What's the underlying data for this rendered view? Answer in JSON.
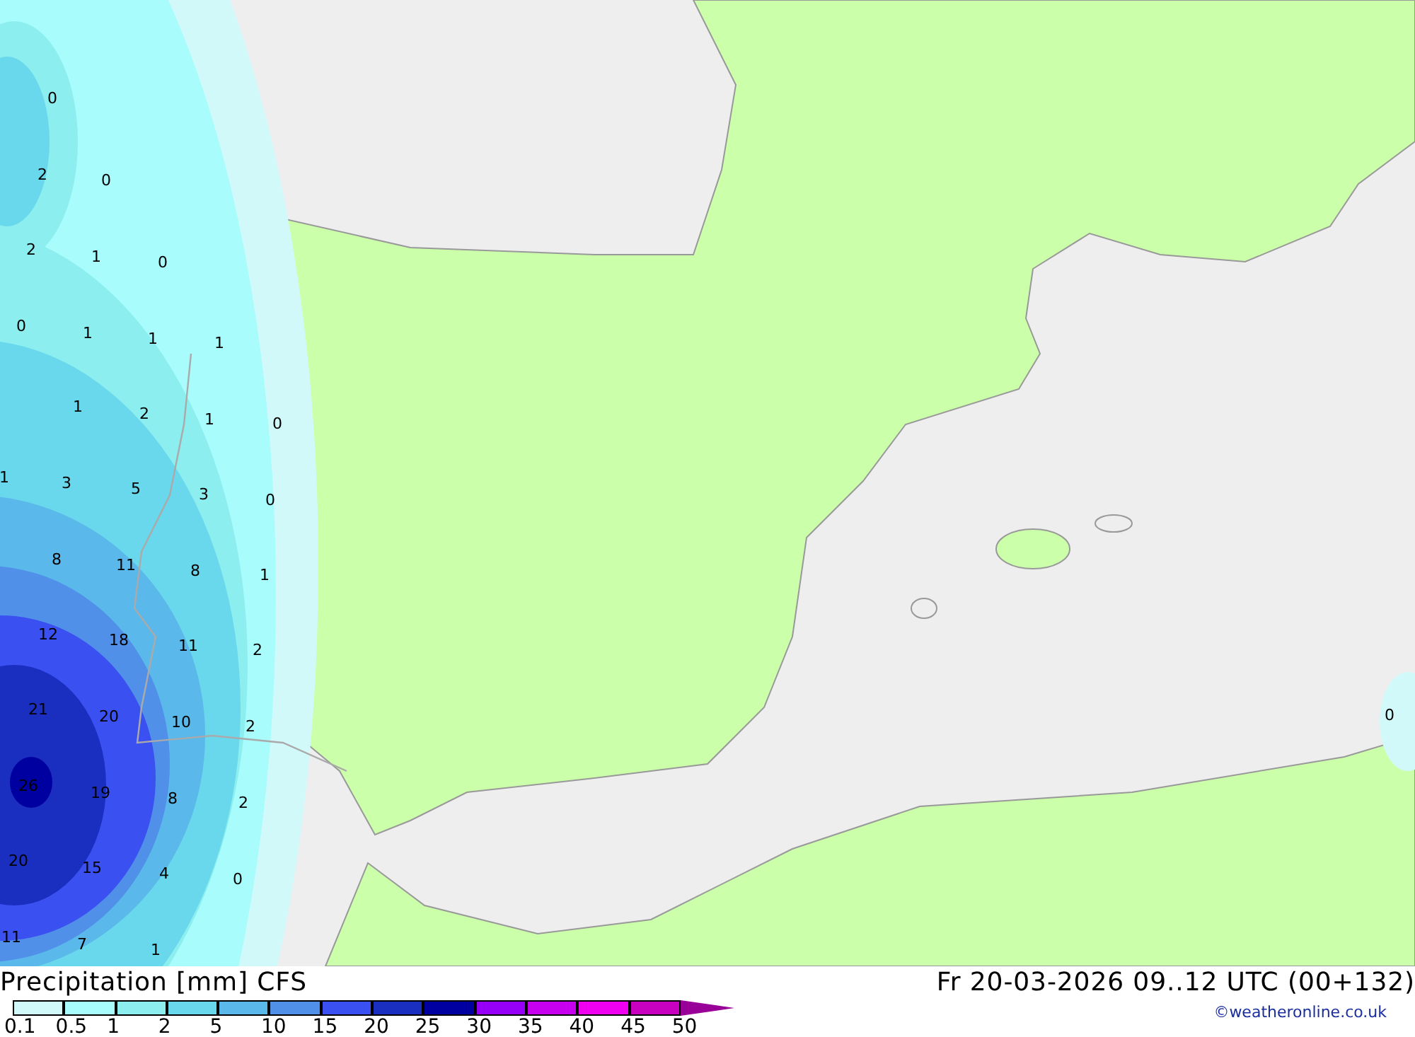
{
  "map": {
    "contour_labels": [
      "0",
      "2",
      "0",
      "2",
      "1",
      "0",
      "0",
      "1",
      "1",
      "1",
      "1",
      "2",
      "1",
      "0",
      "1",
      "3",
      "5",
      "3",
      "0",
      "8",
      "11",
      "8",
      "1",
      "12",
      "18",
      "11",
      "2",
      "21",
      "20",
      "10",
      "2",
      "26",
      "19",
      "8",
      "2",
      "20",
      "15",
      "4",
      "0",
      "11",
      "7",
      "1",
      "0"
    ]
  },
  "title": "Precipitation [mm] CFS",
  "valid_time": "Fr 20-03-2026 09..12 UTC (00+132)",
  "legend": [
    {
      "label": "0.1",
      "color": "#d2f9f9"
    },
    {
      "label": "0.5",
      "color": "#a8fcfc"
    },
    {
      "label": "1",
      "color": "#8ceeee"
    },
    {
      "label": "2",
      "color": "#6ad8ec"
    },
    {
      "label": "5",
      "color": "#5ab8ea"
    },
    {
      "label": "10",
      "color": "#5090e8"
    },
    {
      "label": "15",
      "color": "#3a50f0"
    },
    {
      "label": "20",
      "color": "#1a2ec0"
    },
    {
      "label": "25",
      "color": "#0000a0"
    },
    {
      "label": "30",
      "color": "#9600f8"
    },
    {
      "label": "35",
      "color": "#c800f0"
    },
    {
      "label": "40",
      "color": "#f000f0"
    },
    {
      "label": "45",
      "color": "#c800c0"
    },
    {
      "label": "50",
      "color": "#980098"
    }
  ],
  "credit": "©weatheronline.co.uk"
}
